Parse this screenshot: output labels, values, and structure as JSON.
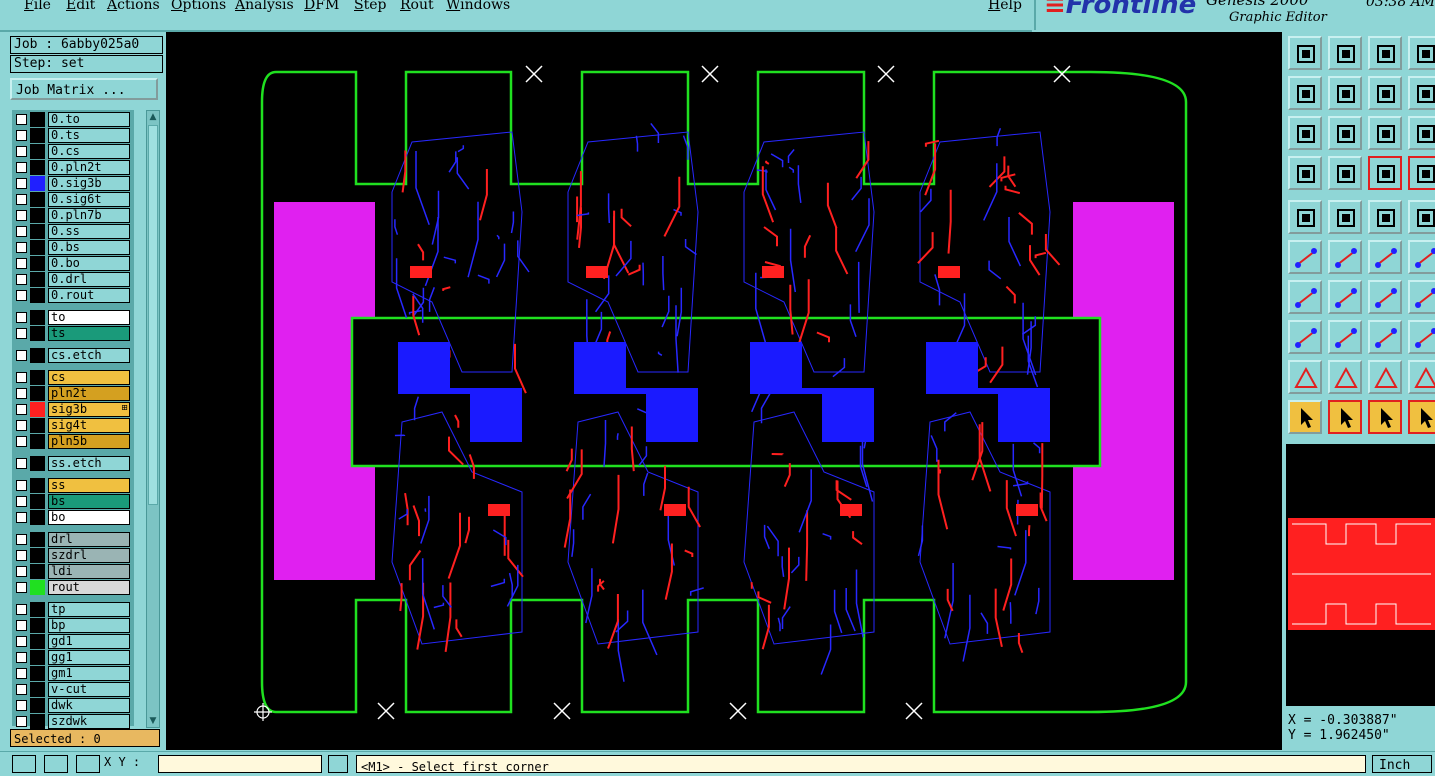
{
  "menu": [
    "File",
    "Edit",
    "Actions",
    "Options",
    "Analysis",
    "DFM",
    "Step",
    "Rout",
    "Windows"
  ],
  "help_label": "Help",
  "brand": {
    "logo": "Frontline",
    "product": "Genesis 2000",
    "subtitle": "Graphic Editor",
    "clock": "03:38 AM"
  },
  "job": {
    "job_label": "Job : 6abby025a0",
    "step_label": "Step: set",
    "matrix_button": "Job Matrix ..."
  },
  "layers": [
    {
      "name": "0.to",
      "color": "#000000",
      "bg": "#8fd6d6"
    },
    {
      "name": "0.ts",
      "color": "#000000",
      "bg": "#8fd6d6"
    },
    {
      "name": "0.cs",
      "color": "#000000",
      "bg": "#8fd6d6"
    },
    {
      "name": "0.pln2t",
      "color": "#000000",
      "bg": "#8fd6d6"
    },
    {
      "name": "0.sig3b",
      "color": "#2020ff",
      "bg": "#8fd6d6"
    },
    {
      "name": "0.sig6t",
      "color": "#000000",
      "bg": "#8fd6d6"
    },
    {
      "name": "0.pln7b",
      "color": "#000000",
      "bg": "#8fd6d6"
    },
    {
      "name": "0.ss",
      "color": "#000000",
      "bg": "#8fd6d6"
    },
    {
      "name": "0.bs",
      "color": "#000000",
      "bg": "#8fd6d6"
    },
    {
      "name": "0.bo",
      "color": "#000000",
      "bg": "#8fd6d6"
    },
    {
      "name": "0.drl",
      "color": "#000000",
      "bg": "#8fd6d6"
    },
    {
      "name": "0.rout",
      "color": "#000000",
      "bg": "#8fd6d6"
    },
    {
      "name": "to",
      "color": "#000000",
      "bg": "#ffffff",
      "gap": true
    },
    {
      "name": "ts",
      "color": "#000000",
      "bg": "#1a9a7a"
    },
    {
      "name": "cs.etch",
      "color": "#000000",
      "bg": "#8fd6d6",
      "gap": true
    },
    {
      "name": "cs",
      "color": "#000000",
      "bg": "#f0c040",
      "gap": true
    },
    {
      "name": "pln2t",
      "color": "#000000",
      "bg": "#d4a020"
    },
    {
      "name": "sig3b",
      "color": "#ff2020",
      "bg": "#f0c040",
      "mark": "⊞"
    },
    {
      "name": "sig4t",
      "color": "#000000",
      "bg": "#f0c040"
    },
    {
      "name": "pln5b",
      "color": "#000000",
      "bg": "#d4a020"
    },
    {
      "name": "ss.etch",
      "color": "#000000",
      "bg": "#8fd6d6",
      "gap": true
    },
    {
      "name": "ss",
      "color": "#000000",
      "bg": "#f0c040",
      "gap": true
    },
    {
      "name": "bs",
      "color": "#000000",
      "bg": "#1a9a7a"
    },
    {
      "name": "bo",
      "color": "#000000",
      "bg": "#ffffff"
    },
    {
      "name": "drl",
      "color": "#000000",
      "bg": "#9ab4b4",
      "gap": true
    },
    {
      "name": "szdrl",
      "color": "#000000",
      "bg": "#9ab4b4"
    },
    {
      "name": "ldi",
      "color": "#000000",
      "bg": "#9ab4b4"
    },
    {
      "name": "rout",
      "color": "#20e020",
      "bg": "#d8d8d8"
    },
    {
      "name": "tp",
      "color": "#000000",
      "bg": "#8fd6d6",
      "gap": true
    },
    {
      "name": "bp",
      "color": "#000000",
      "bg": "#8fd6d6"
    },
    {
      "name": "gd1",
      "color": "#000000",
      "bg": "#8fd6d6"
    },
    {
      "name": "gg1",
      "color": "#000000",
      "bg": "#8fd6d6"
    },
    {
      "name": "gm1",
      "color": "#000000",
      "bg": "#8fd6d6"
    },
    {
      "name": "v-cut",
      "color": "#000000",
      "bg": "#8fd6d6"
    },
    {
      "name": "dwk",
      "color": "#000000",
      "bg": "#8fd6d6"
    },
    {
      "name": "szdwk",
      "color": "#000000",
      "bg": "#8fd6d6"
    }
  ],
  "selected_label": "Selected : 0",
  "coords": {
    "x": "X = -0.303887\"",
    "y": "Y = 1.962450\""
  },
  "bottom": {
    "xy_label": "X Y :",
    "status": "<M1> - Select first corner",
    "units": "Inch"
  },
  "colors": {
    "route_green": "#20e020",
    "trace_red": "#ff2020",
    "trace_blue": "#2828ff",
    "magenta": "#e020f0",
    "bg": "#000000"
  }
}
